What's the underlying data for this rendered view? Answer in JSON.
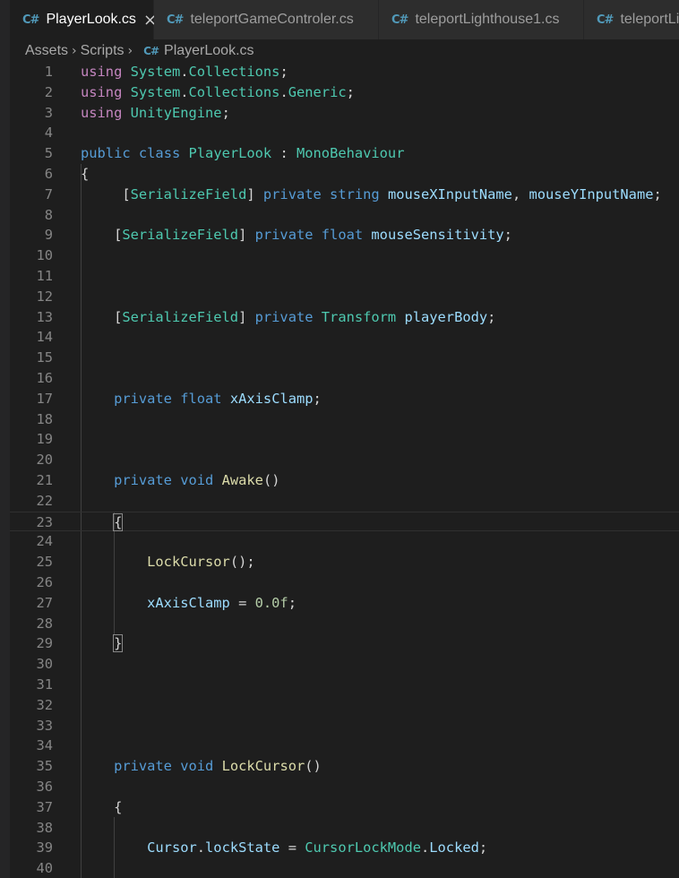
{
  "tabs": [
    {
      "icon": "C#",
      "label": "PlayerLook.cs",
      "active": true,
      "close": "×"
    },
    {
      "icon": "C#",
      "label": "teleportGameControler.cs",
      "active": false
    },
    {
      "icon": "C#",
      "label": "teleportLighthouse1.cs",
      "active": false
    },
    {
      "icon": "C#",
      "label": "teleportLi",
      "active": false
    }
  ],
  "breadcrumb": {
    "parts": [
      "Assets",
      "Scripts"
    ],
    "separator": "›",
    "file_icon": "C#",
    "file": "PlayerLook.cs"
  },
  "editor": {
    "current_line": 23,
    "lines": [
      {
        "n": "1",
        "tokens": [
          [
            "using",
            "ctl"
          ],
          [
            " ",
            "plain"
          ],
          [
            "System",
            "type"
          ],
          [
            ".",
            "plain"
          ],
          [
            "Collections",
            "type"
          ],
          [
            ";",
            "plain"
          ]
        ]
      },
      {
        "n": "2",
        "tokens": [
          [
            "using",
            "ctl"
          ],
          [
            " ",
            "plain"
          ],
          [
            "System",
            "type"
          ],
          [
            ".",
            "plain"
          ],
          [
            "Collections",
            "type"
          ],
          [
            ".",
            "plain"
          ],
          [
            "Generic",
            "type"
          ],
          [
            ";",
            "plain"
          ]
        ]
      },
      {
        "n": "3",
        "tokens": [
          [
            "using",
            "ctl"
          ],
          [
            " ",
            "plain"
          ],
          [
            "UnityEngine",
            "type"
          ],
          [
            ";",
            "plain"
          ]
        ]
      },
      {
        "n": "4",
        "tokens": []
      },
      {
        "n": "5",
        "tokens": [
          [
            "public",
            "kw"
          ],
          [
            " ",
            "plain"
          ],
          [
            "class",
            "kw"
          ],
          [
            " ",
            "plain"
          ],
          [
            "PlayerLook",
            "type"
          ],
          [
            " : ",
            "plain"
          ],
          [
            "MonoBehaviour",
            "type"
          ]
        ]
      },
      {
        "n": "6",
        "tokens": [
          [
            "{",
            "plain"
          ]
        ]
      },
      {
        "n": "7",
        "tokens": [
          [
            "     [",
            "plain"
          ],
          [
            "SerializeField",
            "type"
          ],
          [
            "] ",
            "plain"
          ],
          [
            "private",
            "kw"
          ],
          [
            " ",
            "plain"
          ],
          [
            "string",
            "kw"
          ],
          [
            " ",
            "plain"
          ],
          [
            "mouseXInputName",
            "var"
          ],
          [
            ", ",
            "plain"
          ],
          [
            "mouseYInputName",
            "var"
          ],
          [
            ";",
            "plain"
          ]
        ]
      },
      {
        "n": "8",
        "tokens": []
      },
      {
        "n": "9",
        "tokens": [
          [
            "    [",
            "plain"
          ],
          [
            "SerializeField",
            "type"
          ],
          [
            "] ",
            "plain"
          ],
          [
            "private",
            "kw"
          ],
          [
            " ",
            "plain"
          ],
          [
            "float",
            "kw"
          ],
          [
            " ",
            "plain"
          ],
          [
            "mouseSensitivity",
            "var"
          ],
          [
            ";",
            "plain"
          ]
        ]
      },
      {
        "n": "10",
        "tokens": []
      },
      {
        "n": "11",
        "tokens": []
      },
      {
        "n": "12",
        "tokens": []
      },
      {
        "n": "13",
        "tokens": [
          [
            "    [",
            "plain"
          ],
          [
            "SerializeField",
            "type"
          ],
          [
            "] ",
            "plain"
          ],
          [
            "private",
            "kw"
          ],
          [
            " ",
            "plain"
          ],
          [
            "Transform",
            "type"
          ],
          [
            " ",
            "plain"
          ],
          [
            "playerBody",
            "var"
          ],
          [
            ";",
            "plain"
          ]
        ]
      },
      {
        "n": "14",
        "tokens": []
      },
      {
        "n": "15",
        "tokens": []
      },
      {
        "n": "16",
        "tokens": []
      },
      {
        "n": "17",
        "tokens": [
          [
            "    ",
            "plain"
          ],
          [
            "private",
            "kw"
          ],
          [
            " ",
            "plain"
          ],
          [
            "float",
            "kw"
          ],
          [
            " ",
            "plain"
          ],
          [
            "xAxisClamp",
            "var"
          ],
          [
            ";",
            "plain"
          ]
        ]
      },
      {
        "n": "18",
        "tokens": []
      },
      {
        "n": "19",
        "tokens": []
      },
      {
        "n": "20",
        "tokens": []
      },
      {
        "n": "21",
        "tokens": [
          [
            "    ",
            "plain"
          ],
          [
            "private",
            "kw"
          ],
          [
            " ",
            "plain"
          ],
          [
            "void",
            "kw"
          ],
          [
            " ",
            "plain"
          ],
          [
            "Awake",
            "fn"
          ],
          [
            "()",
            "plain"
          ]
        ]
      },
      {
        "n": "22",
        "tokens": []
      },
      {
        "n": "23",
        "tokens": [
          [
            "    ",
            "plain"
          ],
          [
            "{",
            "plain bracket-match"
          ]
        ]
      },
      {
        "n": "24",
        "tokens": []
      },
      {
        "n": "25",
        "tokens": [
          [
            "        ",
            "plain"
          ],
          [
            "LockCursor",
            "fn"
          ],
          [
            "();",
            "plain"
          ]
        ]
      },
      {
        "n": "26",
        "tokens": []
      },
      {
        "n": "27",
        "tokens": [
          [
            "        ",
            "plain"
          ],
          [
            "xAxisClamp",
            "var"
          ],
          [
            " = ",
            "plain"
          ],
          [
            "0.0f",
            "num"
          ],
          [
            ";",
            "plain"
          ]
        ]
      },
      {
        "n": "28",
        "tokens": []
      },
      {
        "n": "29",
        "tokens": [
          [
            "    ",
            "plain"
          ],
          [
            "}",
            "plain bracket-match"
          ]
        ]
      },
      {
        "n": "30",
        "tokens": []
      },
      {
        "n": "31",
        "tokens": []
      },
      {
        "n": "32",
        "tokens": []
      },
      {
        "n": "33",
        "tokens": []
      },
      {
        "n": "34",
        "tokens": []
      },
      {
        "n": "35",
        "tokens": [
          [
            "    ",
            "plain"
          ],
          [
            "private",
            "kw"
          ],
          [
            " ",
            "plain"
          ],
          [
            "void",
            "kw"
          ],
          [
            " ",
            "plain"
          ],
          [
            "LockCursor",
            "fn"
          ],
          [
            "()",
            "plain"
          ]
        ]
      },
      {
        "n": "36",
        "tokens": []
      },
      {
        "n": "37",
        "tokens": [
          [
            "    ",
            "plain"
          ],
          [
            "{",
            "plain"
          ]
        ]
      },
      {
        "n": "38",
        "tokens": []
      },
      {
        "n": "39",
        "tokens": [
          [
            "        ",
            "plain"
          ],
          [
            "Cursor",
            "var"
          ],
          [
            ".",
            "plain"
          ],
          [
            "lockState",
            "var"
          ],
          [
            " = ",
            "plain"
          ],
          [
            "CursorLockMode",
            "type"
          ],
          [
            ".",
            "plain"
          ],
          [
            "Locked",
            "var"
          ],
          [
            ";",
            "plain"
          ]
        ]
      },
      {
        "n": "40",
        "tokens": []
      }
    ]
  }
}
